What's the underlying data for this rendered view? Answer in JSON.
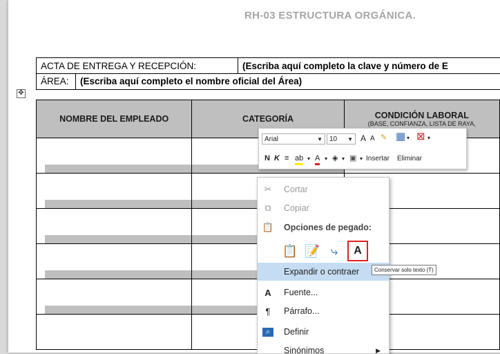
{
  "document": {
    "title": "RH-03 ESTRUCTURA  ORGÁNICA.",
    "acta_label": "ACTA DE ENTREGA Y RECEPCIÓN:",
    "acta_value": "(Escriba aquí completo la clave y número de E",
    "area_label": "ÁREA:",
    "area_value": "(Escriba aquí completo el nombre oficial del Área)"
  },
  "table": {
    "headers": [
      {
        "title": "NOMBRE DEL EMPLEADO",
        "sub": ""
      },
      {
        "title": "CATEGORÍA",
        "sub": ""
      },
      {
        "title": "CONDICIÓN LABORAL",
        "sub": "(BASE, CONFIANZA, LISTA DE RAYA,"
      }
    ]
  },
  "mini_toolbar": {
    "font": "Arial",
    "size": "10",
    "grow_font": "A",
    "shrink_font": "A",
    "bold": "N",
    "italic": "K",
    "insert_label": "Insertar",
    "delete_label": "Eliminar"
  },
  "context_menu": {
    "cut": "Cortar",
    "copy": "Copiar",
    "paste_options": "Opciones de pegado:",
    "expand": "Expandir o contraer",
    "font": "Fuente...",
    "paragraph": "Párrafo...",
    "define": "Definir",
    "synonyms": "Sinónimos"
  },
  "tooltip": "Conservar solo texto (T)",
  "colors": {
    "highlight": "#c5dcf2",
    "selection_border": "#e02020",
    "header_fill": "#bfbfbf"
  }
}
